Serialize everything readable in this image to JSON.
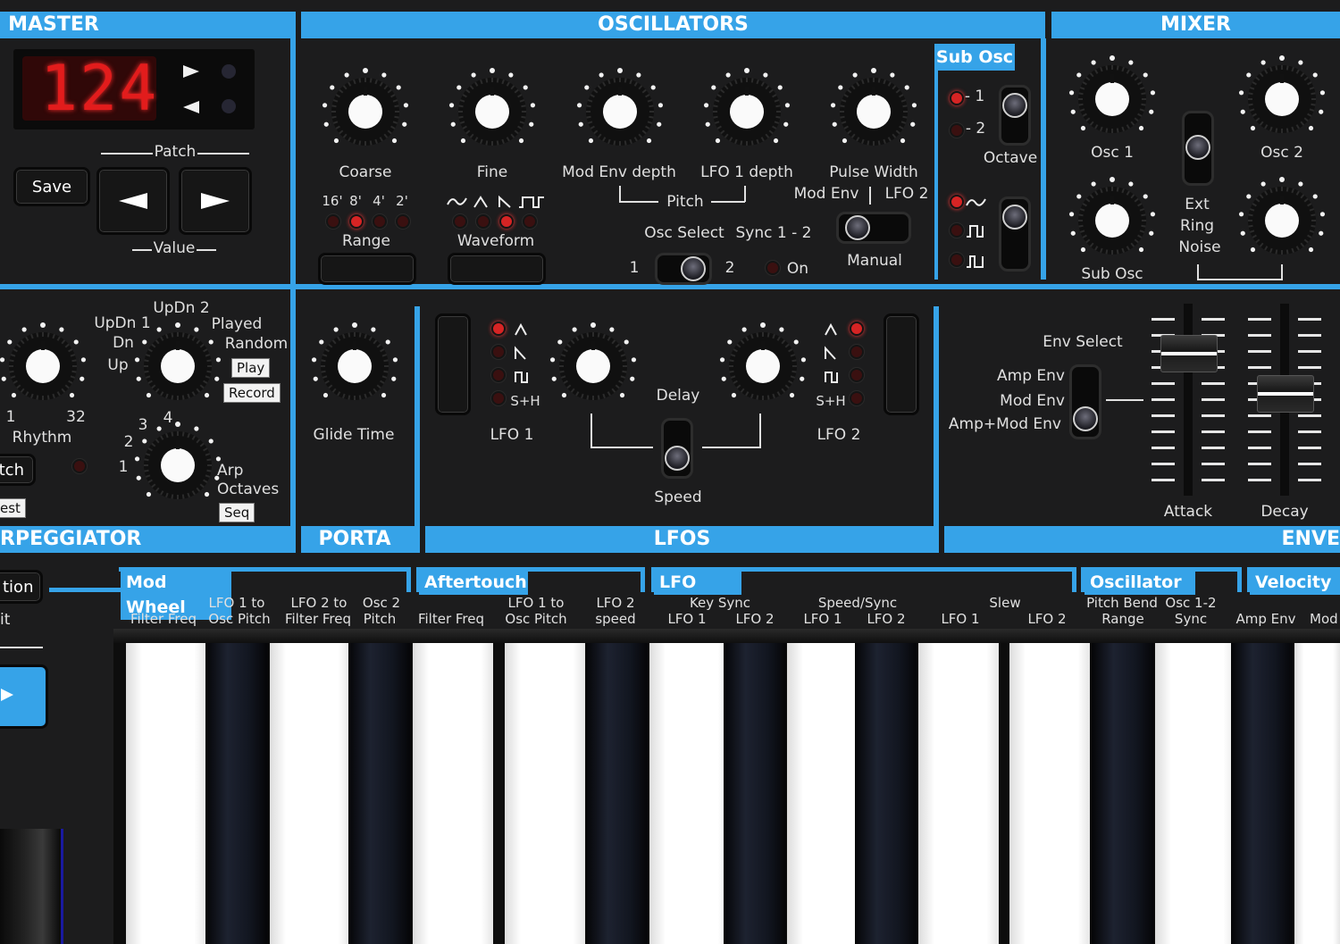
{
  "colors": {
    "accent": "#36a3e8",
    "panel": "#1c1c1d",
    "led_on": "#d62424",
    "display_digits": "#e21c1c"
  },
  "master": {
    "title": "MASTER",
    "display_value": "124",
    "patch_label": "Patch",
    "value_label": "Value",
    "save_label": "Save",
    "prev_icon": "left-arrow-icon",
    "next_icon": "right-arrow-icon"
  },
  "oscillators": {
    "title": "OSCILLATORS",
    "knobs": [
      "Coarse",
      "Fine",
      "Mod Env depth",
      "LFO 1 depth",
      "Pulse Width"
    ],
    "range_label": "Range",
    "range_options": [
      "16'",
      "8'",
      "4'",
      "2'"
    ],
    "range_selected": "8'",
    "waveform_label": "Waveform",
    "waveform_selected_index": 2,
    "pitch_label": "Pitch",
    "pw_source_label": "Mod Env",
    "pw_source_label2": "LFO 2",
    "manual_label": "Manual",
    "osc_select_label": "Osc Select",
    "osc_select_1": "1",
    "osc_select_2": "2",
    "sync_label": "Sync 1 - 2",
    "sync_on_label": "On"
  },
  "sub_osc": {
    "title": "Sub Osc",
    "octave_minus1": "- 1",
    "octave_minus2": "- 2",
    "octave_label": "Octave"
  },
  "mixer": {
    "title": "MIXER",
    "osc1": "Osc 1",
    "osc2": "Osc 2",
    "sub_osc": "Sub Osc",
    "ext": "Ext",
    "ring": "Ring",
    "noise": "Noise"
  },
  "arpeggiator": {
    "title": "RPEGGIATOR",
    "mode_updn2": "UpDn 2",
    "mode_updn1": "UpDn 1",
    "mode_dn": "Dn",
    "mode_up": "Up",
    "mode_played": "Played",
    "mode_random": "Random",
    "play_tag": "Play",
    "record_tag": "Record",
    "rhythm_label": "Rhythm",
    "rhythm_min": "1",
    "rhythm_max": "32",
    "oct_1": "1",
    "oct_2": "2",
    "oct_3": "3",
    "oct_4": "4",
    "arp_label": "Arp",
    "octaves_label": "Octaves",
    "seq_tag": "Seq",
    "latch_partial": "tch",
    "est_partial": "est"
  },
  "porta": {
    "title": "PORTA",
    "glide_label": "Glide Time"
  },
  "lfos": {
    "title": "LFOS",
    "lfo1_label": "LFO 1",
    "lfo2_label": "LFO 2",
    "delay_label": "Delay",
    "speed_label": "Speed",
    "sh_label": "S+H",
    "lfo1_selected_index": 0,
    "lfo2_selected_index": 0
  },
  "envelopes": {
    "title": "ENVE",
    "env_select": "Env Select",
    "amp_env": "Amp Env",
    "mod_env": "Mod Env",
    "amp_mod_env": "Amp+Mod Env",
    "attack": "Attack",
    "decay": "Decay",
    "attack_level": 0.78,
    "decay_level": 0.5
  },
  "left_strip": {
    "partial_1": "tion",
    "partial_2": "it"
  },
  "mod_sections": {
    "mod_wheel": "Mod Wheel",
    "aftertouch": "Aftertouch",
    "lfo": "LFO",
    "oscillator": "Oscillator",
    "velocity": "Velocity",
    "mw_filter_freq": "Filter Freq",
    "mw_lfo1_to": "LFO 1 to",
    "mw_osc_pitch": "Osc Pitch",
    "mw_lfo2_to": "LFO 2 to",
    "mw_filter_freq2": "Filter Freq",
    "mw_osc2": "Osc 2",
    "mw_pitch": "Pitch",
    "at_filter_freq": "Filter Freq",
    "at_lfo1_to": "LFO 1 to",
    "at_osc_pitch": "Osc Pitch",
    "at_lfo2": "LFO 2",
    "at_speed": "speed",
    "lfo_key_sync": "Key Sync",
    "lfo_ks_lfo1": "LFO 1",
    "lfo_ks_lfo2": "LFO 2",
    "lfo_speed_sync": "Speed/Sync",
    "lfo_ss_lfo1": "LFO 1",
    "lfo_ss_lfo2": "LFO 2",
    "lfo_slew": "Slew",
    "lfo_sl_lfo1": "LFO 1",
    "lfo_sl_lfo2": "LFO 2",
    "osc_pitch_bend": "Pitch Bend",
    "osc_range": "Range",
    "osc_12": "Osc 1-2",
    "osc_sync": "Sync",
    "vel_amp_env": "Amp Env",
    "vel_mod": "Mod"
  }
}
